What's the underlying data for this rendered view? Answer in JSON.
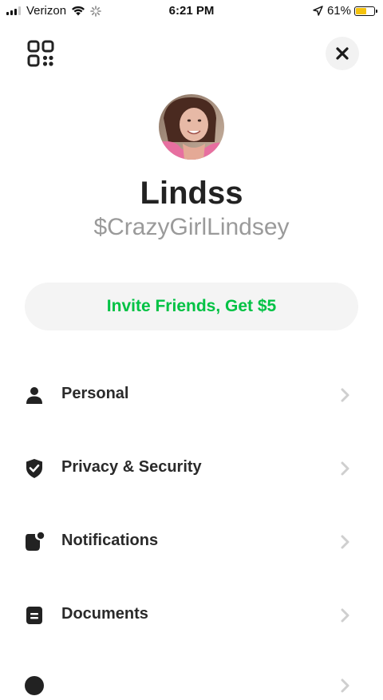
{
  "status_bar": {
    "carrier": "Verizon",
    "time": "6:21 PM",
    "battery_percent": "61%",
    "battery_level": 0.61,
    "battery_color": "#f4c20d"
  },
  "header": {
    "qr_icon": "qr-code-icon",
    "close_icon": "close-icon"
  },
  "profile": {
    "name": "Lindss",
    "cashtag": "$CrazyGirlLindsey"
  },
  "invite_button": {
    "label": "Invite Friends, Get $5",
    "color": "#00c244"
  },
  "menu": [
    {
      "label": "Personal",
      "icon": "person-icon"
    },
    {
      "label": "Privacy & Security",
      "icon": "shield-check-icon"
    },
    {
      "label": "Notifications",
      "icon": "notification-icon"
    },
    {
      "label": "Documents",
      "icon": "document-icon"
    }
  ]
}
